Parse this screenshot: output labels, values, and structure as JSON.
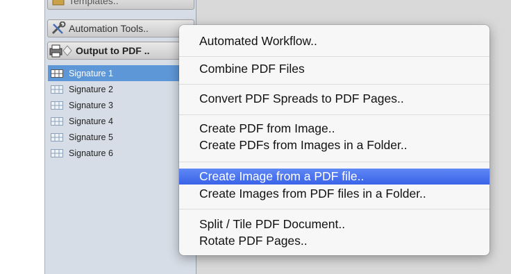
{
  "panel": {
    "toolbar": {
      "templates_label": "Templates..",
      "automation_label": "Automation Tools..",
      "output_label": "Output to PDF .."
    },
    "signatures": [
      {
        "label": "Signature 1",
        "selected": true
      },
      {
        "label": "Signature 2",
        "selected": false
      },
      {
        "label": "Signature 3",
        "selected": false
      },
      {
        "label": "Signature 4",
        "selected": false
      },
      {
        "label": "Signature 5",
        "selected": false
      },
      {
        "label": "Signature 6",
        "selected": false
      }
    ]
  },
  "menu": {
    "items": [
      {
        "label": "Automated Workflow.."
      },
      {
        "label": "Combine PDF Files"
      },
      {
        "label": "Convert PDF Spreads to PDF Pages.."
      },
      {
        "label": "Create PDF from Image.."
      },
      {
        "label": "Create PDFs from Images in a Folder.."
      },
      {
        "label": "Create Image from a PDF file..",
        "highlighted": true
      },
      {
        "label": "Create Images from PDF files in a Folder.."
      },
      {
        "label": "Split / Tile  PDF Document.."
      },
      {
        "label": "Rotate PDF Pages.."
      }
    ]
  },
  "colors": {
    "selection_blue": "#5e97d8",
    "menu_highlight": "#3a63e8",
    "panel_bg": "#d6dde6"
  }
}
